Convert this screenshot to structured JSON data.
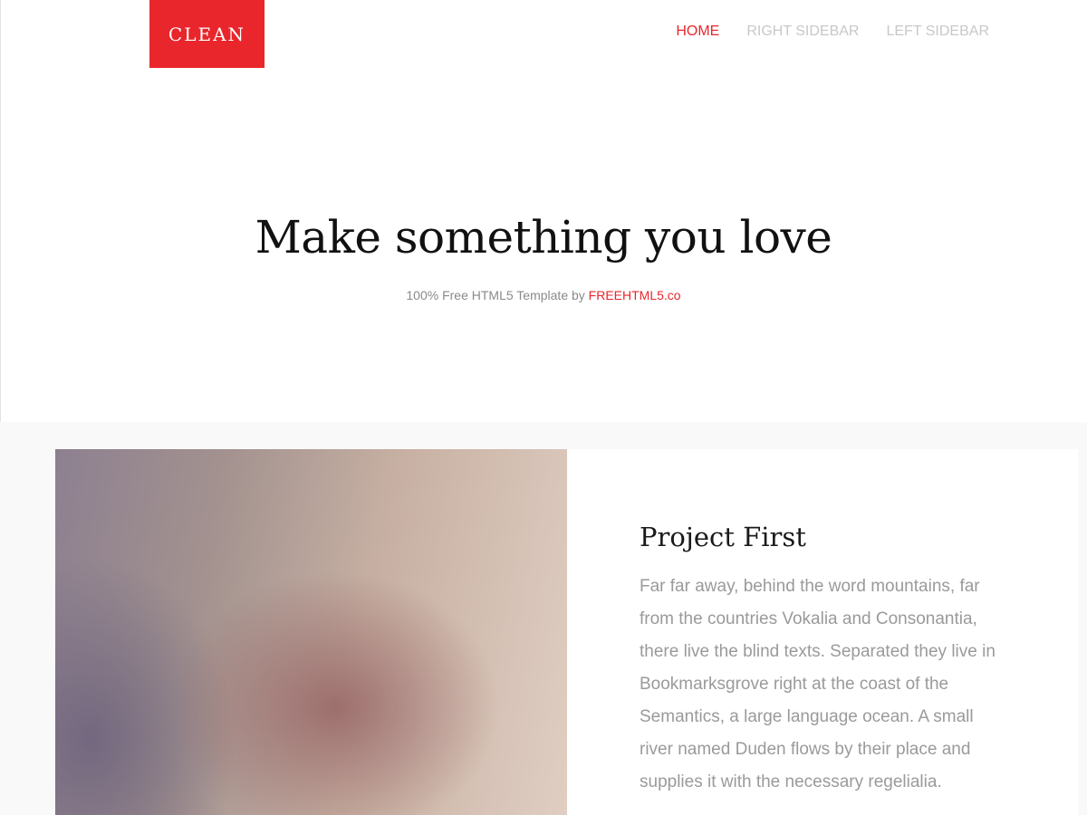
{
  "header": {
    "logo": "CLEAN",
    "nav": [
      {
        "label": "HOME",
        "active": true
      },
      {
        "label": "RIGHT SIDEBAR",
        "active": false
      },
      {
        "label": "LEFT SIDEBAR",
        "active": false
      }
    ]
  },
  "hero": {
    "title": "Make something you love",
    "subtitle_prefix": "100% Free HTML5 Template by ",
    "subtitle_link": "FREEHTML5.co"
  },
  "project": {
    "title": "Project First",
    "text": "Far far away, behind the word mountains, far from the countries Vokalia and Consonantia, there live the blind texts. Separated they live in Bookmarksgrove right at the coast of the Semantics, a large language ocean. A small river named Duden flows by their place and supplies it with the necessary regelialia."
  },
  "colors": {
    "accent": "#e8262b",
    "nav_inactive": "#c8c8c8",
    "section_bg": "#f9f9f9"
  }
}
